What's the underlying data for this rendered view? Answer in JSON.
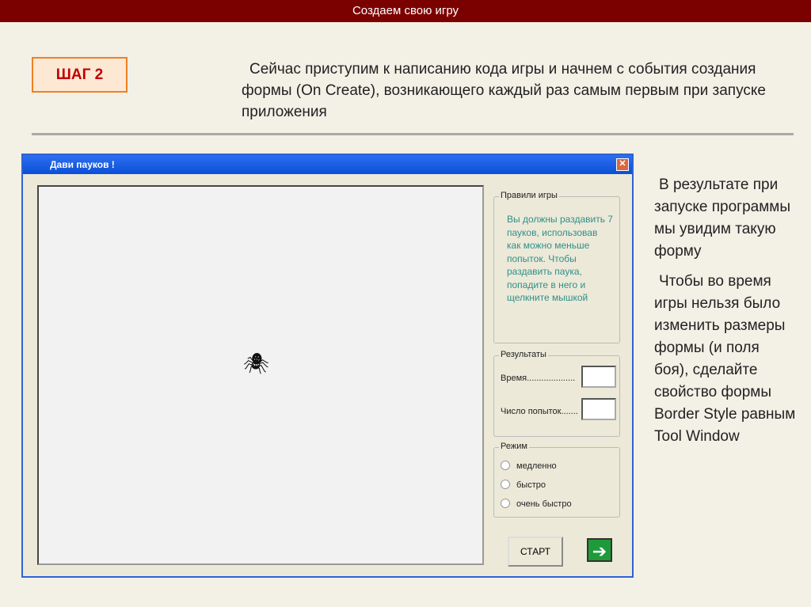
{
  "header": {
    "title": "Создаем свою игру"
  },
  "step": {
    "label": "ШАГ 2"
  },
  "intro": "Сейчас приступим к написанию кода игры и начнем с события создания формы (On Create), возникающего каждый раз самым первым при запуске приложения",
  "window": {
    "title": "Дави пауков !",
    "close_icon": "close-icon",
    "rules": {
      "legend": "Правили игры",
      "text": "Вы должны раздавить 7 пауков, использовав как можно меньше попыток. Чтобы раздавить паука, попадите в него и щелкните мышкой"
    },
    "results": {
      "legend": "Результаты",
      "time_label": "Время....................",
      "attempts_label": "Число попыток.......",
      "time_value": "",
      "attempts_value": ""
    },
    "mode": {
      "legend": "Режим",
      "options": [
        "медленно",
        "быстро",
        "очень быстро"
      ]
    },
    "start_label": "СТАРТ"
  },
  "side": {
    "p1": "В результате при запуске программы мы увидим  такую форму",
    "p2": "Чтобы во время игры нельзя было изменить размеры формы (и поля боя), сделайте свойство формы Border Style равным Tool Window"
  }
}
